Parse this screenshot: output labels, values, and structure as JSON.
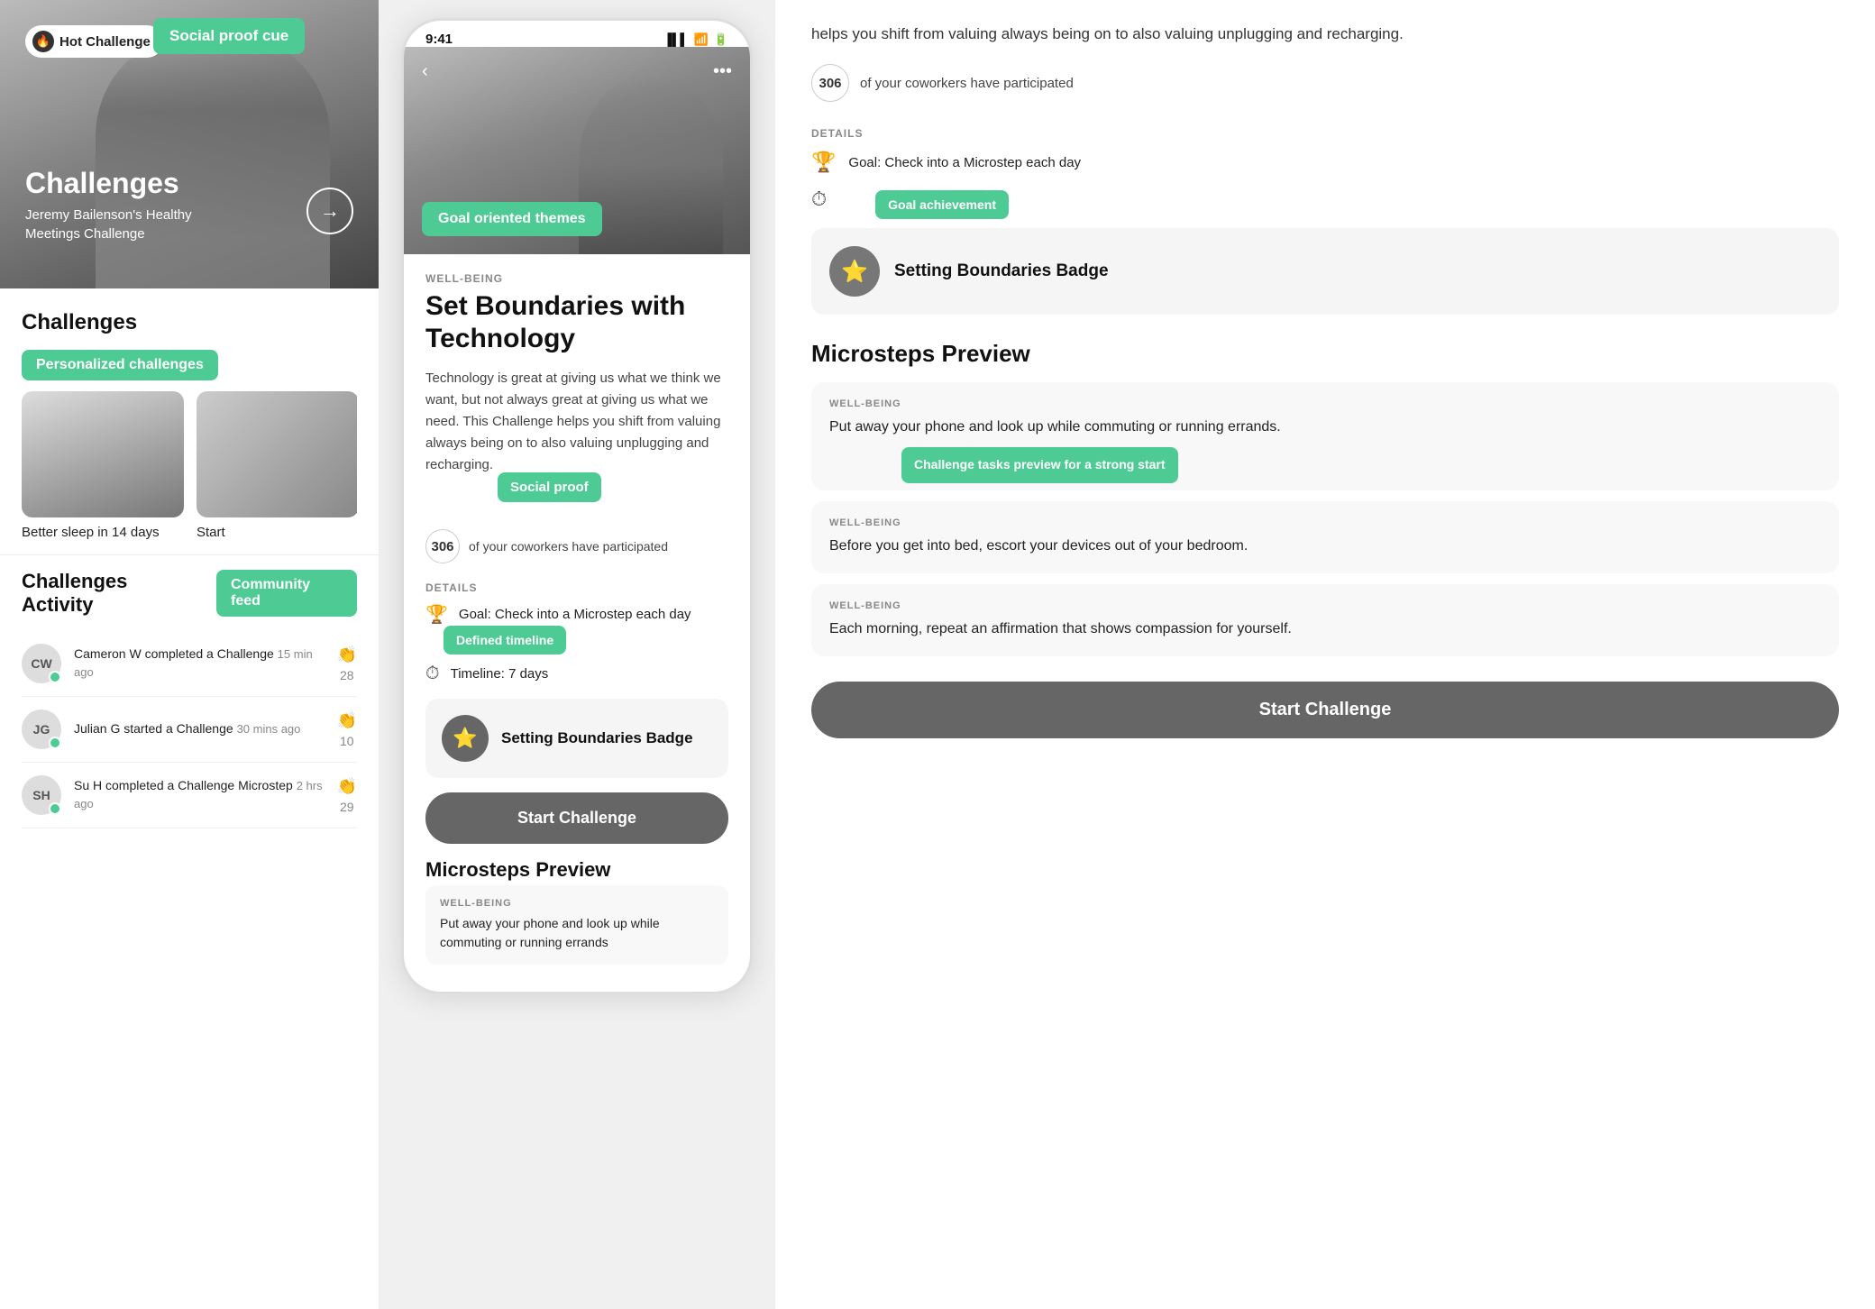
{
  "left": {
    "hero": {
      "hot_label": "Hot Challenge",
      "social_proof_cue": "Social proof cue",
      "title": "Challenges",
      "subtitle": "Jeremy Bailenson's Healthy Meetings Challenge"
    },
    "challenges": {
      "section_title": "Challenges",
      "personalized_label": "Personalized challenges",
      "cards": [
        {
          "label": "Better sleep in 14 days"
        },
        {
          "label": "Start"
        }
      ]
    },
    "activity": {
      "section_title": "Challenges Activity",
      "community_feed_label": "Community feed",
      "items": [
        {
          "initials": "CW",
          "text": "Cameron W completed a Challenge",
          "time": "15 min ago",
          "count": "28"
        },
        {
          "initials": "JG",
          "text": "Julian G started a Challenge",
          "time": "30 mins ago",
          "count": "10"
        },
        {
          "initials": "SH",
          "text": "Su H completed a Challenge Microstep",
          "time": "2 hrs ago",
          "count": "29"
        }
      ]
    }
  },
  "middle": {
    "status_time": "9:41",
    "hero": {
      "goal_oriented_label": "Goal oriented themes"
    },
    "category": "WELL-BEING",
    "title": "Set Boundaries with Technology",
    "description": "Technology is great at giving us what we think we want, but not always great at giving us what we need. This Challenge helps you shift from valuing always being on to also valuing unplugging and recharging.",
    "social_proof_label": "Social proof",
    "coworkers_count": "306",
    "coworkers_text": "of your coworkers have participated",
    "details_label": "DETAILS",
    "goal_text": "Goal: Check into a Microstep each day",
    "defined_timeline_label": "Defined timeline",
    "timeline_text": "Timeline: 7 days",
    "badge": {
      "name": "Setting Boundaries Badge"
    },
    "start_btn": "Start Challenge",
    "microsteps_title": "Microsteps Preview",
    "microsteps": [
      {
        "category": "WELL-BEING",
        "text": "Put away your phone and look up while commuting or running errands"
      }
    ]
  },
  "right": {
    "description": "helps you shift from valuing always being on to also valuing unplugging and recharging.",
    "coworkers_count": "306",
    "coworkers_text": "of your coworkers have participated",
    "details_label": "DETAILS",
    "goal_text": "Goal: Check into a Microstep each day",
    "goal_achievement_label": "Goal achievement",
    "badge_name": "Setting Boundaries Badge",
    "microsteps_title": "Microsteps Preview",
    "challenge_tasks_label": "Challenge tasks preview\nfor a strong start",
    "microsteps": [
      {
        "category": "WELL-BEING",
        "text": "Put away your phone and look up while commuting or running errands."
      },
      {
        "category": "WELL-BEING",
        "text": "Before you get into bed, escort your devices out of your bedroom."
      },
      {
        "category": "WELL-BEING",
        "text": "Each morning, repeat an affirmation that shows compassion for yourself."
      }
    ],
    "start_btn": "Start Challenge"
  }
}
